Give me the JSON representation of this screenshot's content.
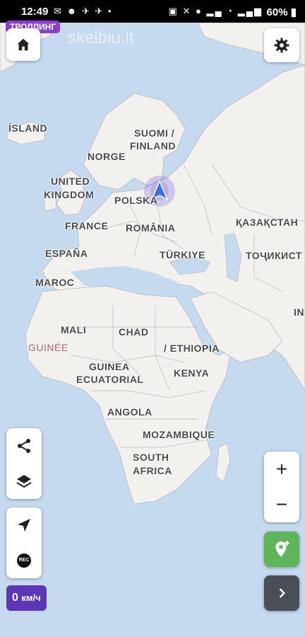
{
  "status_bar": {
    "time": "12:49",
    "battery": "60%",
    "left_icons": [
      "mail-icon",
      "smile-icon",
      "plane-icon",
      "plane-icon",
      "dot-icon"
    ],
    "right_icons": [
      "lock-icon",
      "mute-icon",
      "location-icon",
      "signal-icon",
      "wifi-icon",
      "signal-icon",
      "battery-icon"
    ]
  },
  "watermark": "skelbiu.lt",
  "mode_chip": "ТРОЛЛИНГ",
  "map": {
    "labels": {
      "island": "ÍSLAND",
      "suomi": "SUOMI /",
      "finland": "FINLAND",
      "norge": "NORGE",
      "united": "UNITED",
      "kingdom": "KINGDOM",
      "polska": "POLSKA",
      "france": "FRANCE",
      "romania": "ROMÂNIA",
      "espana": "ESPAÑA",
      "turkiye": "TÜRKIYE",
      "maroc": "MAROC",
      "mali": "MALI",
      "chad": "CHAD",
      "guinee": "GUINÉE",
      "ethiopia": "/ ETHIOPIA",
      "guinea": "GUINEA",
      "ecuatorial": "ECUATORIAL",
      "kenya": "KENYA",
      "angola": "ANGOLA",
      "mozambique": "MOZAMBIQUE",
      "south": "SOUTH",
      "africa": "AFRICA",
      "kazakhstan": "ҚАЗАҚСТАН",
      "tojikiston": "ТОҶИКИСТ",
      "in": "IN"
    },
    "colors": {
      "water": "#c5d9ef",
      "land": "#f2f1ee",
      "border": "#b9b7bf"
    }
  },
  "buttons": {
    "home": "home-icon",
    "settings": "gear-icon",
    "share": "share-icon",
    "layers": "layers-icon",
    "navigate": "navigation-arrow-icon",
    "rec": "REC",
    "zoom_in": "+",
    "zoom_out": "−",
    "add_point": "add-location-icon",
    "expand": "chevron-right-icon"
  },
  "speed": {
    "value": "0",
    "unit": "км/ч"
  }
}
